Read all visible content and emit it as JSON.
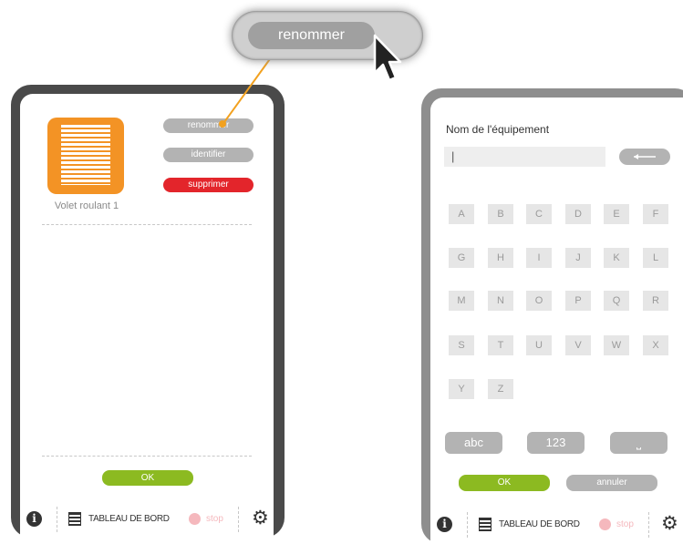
{
  "callout": {
    "label": "renommer"
  },
  "left_panel": {
    "device_name": "Volet roulant 1",
    "actions": {
      "rename": "renommer",
      "identify": "identifier",
      "delete": "supprimer"
    },
    "ok_label": "OK"
  },
  "right_panel": {
    "title": "Nom de l'équipement",
    "input_value": "|",
    "keys": [
      "A",
      "B",
      "C",
      "D",
      "E",
      "F",
      "G",
      "H",
      "I",
      "J",
      "K",
      "L",
      "M",
      "N",
      "O",
      "P",
      "Q",
      "R",
      "S",
      "T",
      "U",
      "V",
      "W",
      "X",
      "Y",
      "Z"
    ],
    "modes": {
      "letters": "abc",
      "numbers": "123",
      "space": "⎵"
    },
    "ok_label": "OK",
    "cancel_label": "annuler"
  },
  "footer": {
    "info": "i",
    "dashboard": "TABLEAU DE BORD",
    "stop": "stop"
  },
  "colors": {
    "orange": "#f39325",
    "red": "#e3252b",
    "green": "#8cba21",
    "gray": "#b3b3b3"
  }
}
